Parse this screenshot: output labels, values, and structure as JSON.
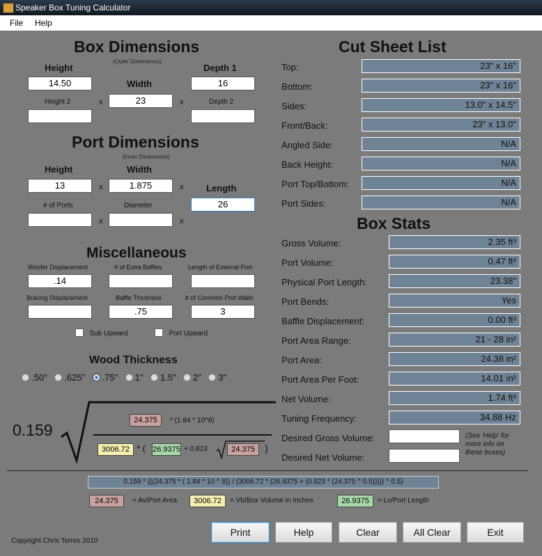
{
  "window": {
    "title": "Speaker Box Tuning Calculator"
  },
  "menu": {
    "file": "File",
    "help": "Help"
  },
  "box": {
    "title": "Box Dimensions",
    "subtitle": "(Outer Dimensions)",
    "height_label": "Height",
    "width_label": "Width",
    "depth1_label": "Depth 1",
    "height2_label": "Height 2",
    "depth2_label": "Depth 2",
    "height": "14.50",
    "width": "23",
    "depth1": "16",
    "height2": "",
    "depth2": "",
    "x": "x"
  },
  "port": {
    "title": "Port Dimensions",
    "subtitle": "(Inner Dimensions)",
    "height_label": "Height",
    "width_label": "Width",
    "length_label": "Length",
    "ports_label": "# of Ports",
    "diameter_label": "Diameter",
    "height": "13",
    "width": "1.875",
    "length": "26",
    "ports": "",
    "diameter": ""
  },
  "misc": {
    "title": "Miscellaneous",
    "woofer_label": "Woofer Displacement",
    "extra_baffles_label": "# of Extra Baffles",
    "ext_port_label": "Length of External Port",
    "bracing_label": "Bracing Displacement",
    "baffle_thick_label": "Baffle Thickness",
    "common_walls_label": "# of Common Port Walls",
    "woofer": ".14",
    "extra_baffles": "",
    "ext_port": "",
    "bracing": "",
    "baffle_thick": ".75",
    "common_walls": "3",
    "sub_upward": "Sub Upward",
    "port_upward": "Port Upward"
  },
  "wood": {
    "title": "Wood Thickness",
    "options": [
      ".50\"",
      ".625\"",
      ".75\"",
      "1\"",
      "1.5\"",
      "2\"",
      "3\""
    ],
    "selected": ".75\""
  },
  "formula": {
    "constant": "0.159",
    "av": "24.375",
    "mult": "* (1.84 * 10^8)",
    "vb": "3006.72",
    "star_paren": "* (",
    "lv": "26.9375",
    "plus": "+ 0.823",
    "av2": "24.375",
    "close": ")",
    "expression": "0.159 * (((24.375 * ( 1.84 * 10 ^ 8)) / (3006.72 * (26.9375 + (0.823 * (24.375 ^ 0.5))))) ^ 0.5)",
    "legend_av": "= Av/Port Area",
    "legend_vb": "= Vb/Box Volume in Inches",
    "legend_lv": "= Lv/Port Length"
  },
  "cut": {
    "title": "Cut Sheet List",
    "rows": [
      {
        "label": "Top:",
        "value": "23\" x 16\""
      },
      {
        "label": "Bottom:",
        "value": "23\" x 16\""
      },
      {
        "label": "Sides:",
        "value": "13.0\" x 14.5\""
      },
      {
        "label": "Front/Back:",
        "value": "23\" x 13.0\""
      },
      {
        "label": "Angled Side:",
        "value": "N/A"
      },
      {
        "label": "Back Height:",
        "value": "N/A"
      },
      {
        "label": "Port Top/Bottom:",
        "value": "N/A"
      },
      {
        "label": "Port Sides:",
        "value": "N/A"
      }
    ]
  },
  "stats": {
    "title": "Box Stats",
    "rows": [
      {
        "label": "Gross Volume:",
        "value": "2.35 ft³"
      },
      {
        "label": "Port Volume:",
        "value": "0.47 ft³"
      },
      {
        "label": "Physical Port Length:",
        "value": "23.38\""
      },
      {
        "label": "Port Bends:",
        "value": "Yes"
      },
      {
        "label": "Baffle Displacement:",
        "value": "0.00 ft³"
      },
      {
        "label": "Port Area Range:",
        "value": "21 - 28 in²"
      },
      {
        "label": "Port Area:",
        "value": "24.38 in²"
      },
      {
        "label": "Port Area Per Foot:",
        "value": "14.01 in²"
      },
      {
        "label": "Net Volume:",
        "value": "1.74 ft³"
      },
      {
        "label": "Tuning Frequency:",
        "value": "34.88 Hz"
      }
    ],
    "desired_gross_label": "Desired Gross Volume:",
    "desired_net_label": "Desired Net Volume:",
    "desired_gross": "",
    "desired_net": "",
    "help_note": "(See 'Help' for more info on these boxes)"
  },
  "buttons": {
    "print": "Print",
    "help": "Help",
    "clear": "Clear",
    "all_clear": "All Clear",
    "exit": "Exit"
  },
  "copyright": "Copyright Chris Torres 2010"
}
